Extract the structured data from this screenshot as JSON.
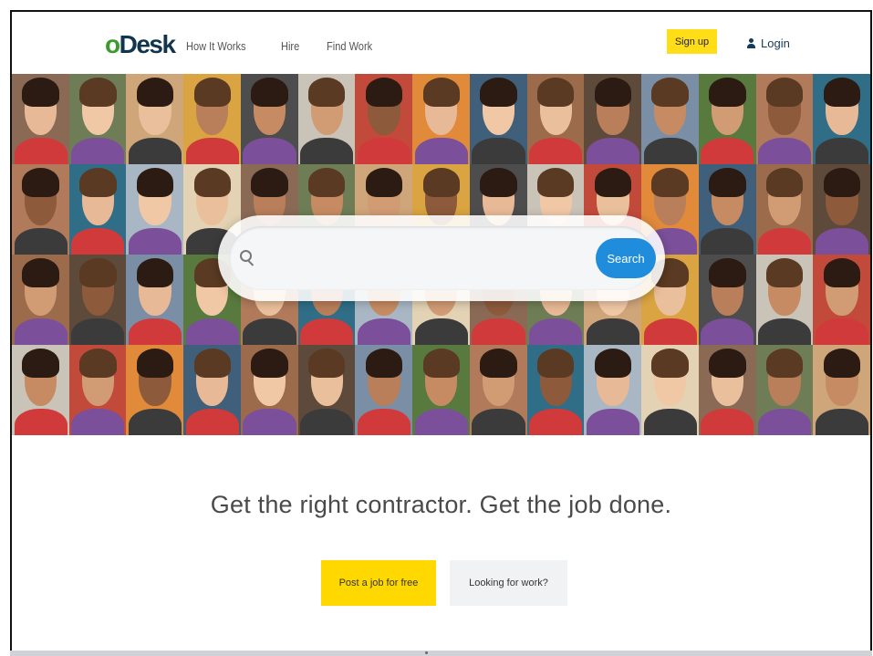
{
  "header": {
    "logo": {
      "o": "o",
      "desk": "Desk"
    },
    "nav": [
      {
        "label": "How It Works"
      },
      {
        "label": "Hire"
      },
      {
        "label": "Find Work"
      }
    ],
    "signup_label": "Sign up",
    "login_label": "Login"
  },
  "search": {
    "placeholder": "",
    "button_label": "Search"
  },
  "hero": {
    "tagline": "Get the right contractor. Get the job done.",
    "post_job_label": "Post a job for free",
    "find_work_label": "Looking for work?"
  },
  "colors": {
    "brand_green": "#3d9b2e",
    "brand_navy": "#12354f",
    "cta_yellow": "#ffde17",
    "search_blue": "#1f8ddc"
  }
}
